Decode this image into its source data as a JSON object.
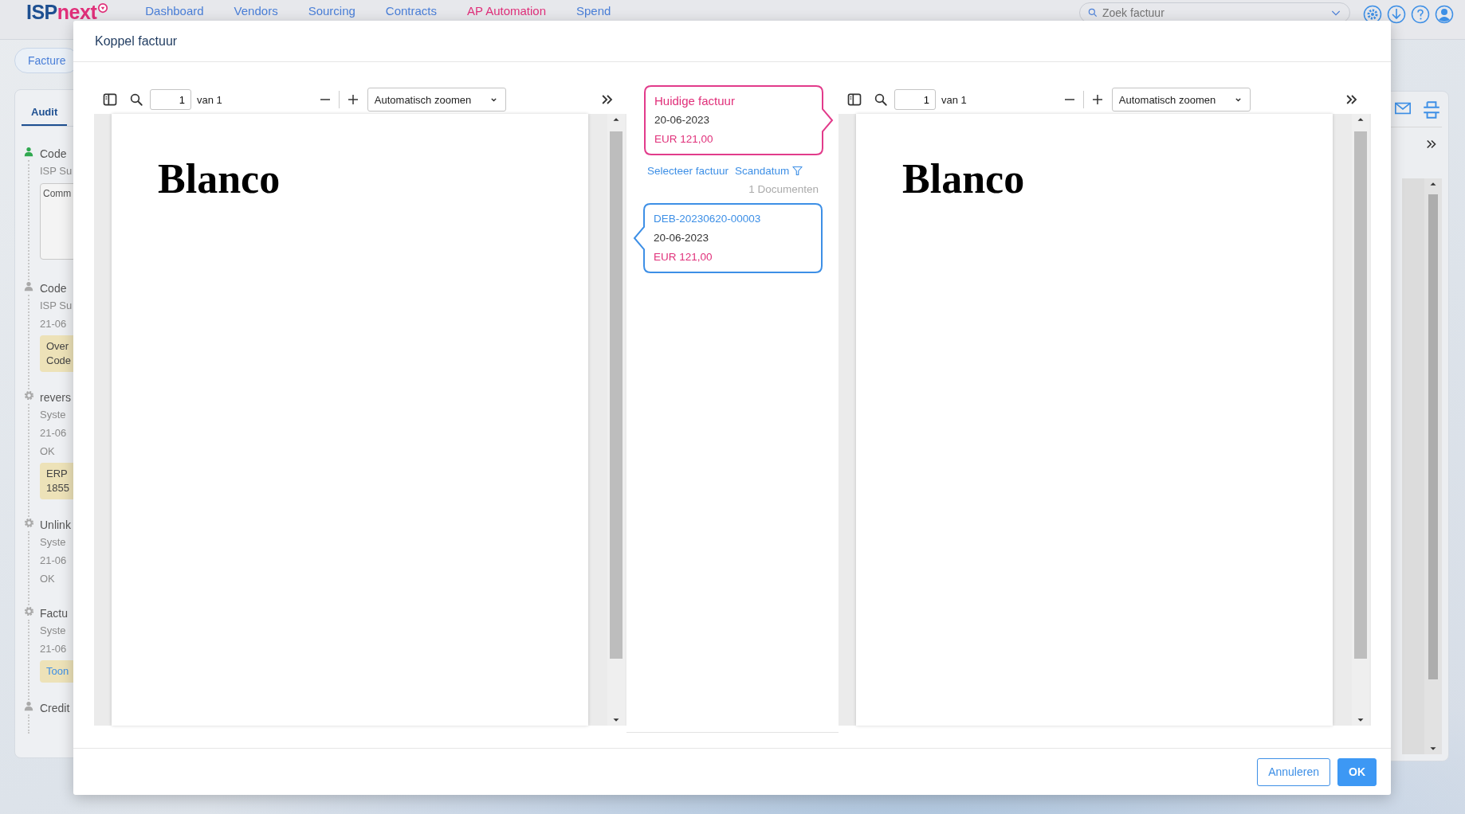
{
  "app_header": {
    "logo": {
      "prefix": "ISP",
      "suffix": "next"
    },
    "nav": [
      {
        "label": "Dashboard",
        "selected": false
      },
      {
        "label": "Vendors",
        "selected": false
      },
      {
        "label": "Sourcing",
        "selected": false
      },
      {
        "label": "Contracts",
        "selected": false
      },
      {
        "label": "AP Automation",
        "selected": true
      },
      {
        "label": "Spend",
        "selected": false
      }
    ],
    "search": {
      "placeholder": "Zoek factuur"
    }
  },
  "breadcrumb_tab": "Facture",
  "audit_panel": {
    "tabs": [
      {
        "label": "Audit",
        "selected": true
      }
    ],
    "entries": [
      {
        "kind": "user",
        "color": "#2fa84f",
        "title": "Code",
        "lines": [
          "ISP Su"
        ],
        "comment_placeholder": "Comm"
      },
      {
        "kind": "user",
        "color": "#a9a9a9",
        "title": "Code",
        "lines": [
          "ISP Su",
          "21-06"
        ],
        "note": {
          "kind": "text",
          "lines": [
            "Over",
            "Code"
          ]
        }
      },
      {
        "kind": "system",
        "color": "#a9a9a9",
        "title": "revers",
        "lines": [
          "Syste",
          "21-06",
          "OK"
        ],
        "note": {
          "kind": "text",
          "lines": [
            "ERP",
            "1855"
          ]
        }
      },
      {
        "kind": "system",
        "color": "#a9a9a9",
        "title": "Unlink",
        "lines": [
          "Syste",
          "21-06",
          "OK"
        ]
      },
      {
        "kind": "system",
        "color": "#a9a9a9",
        "title": "Factu",
        "lines": [
          "Syste",
          "21-06"
        ],
        "note": {
          "kind": "link",
          "lines": [
            "Toon"
          ]
        }
      },
      {
        "kind": "user",
        "color": "#a9a9a9",
        "title": "Credit"
      }
    ]
  },
  "dialog": {
    "title": "Koppel factuur",
    "viewers": [
      {
        "page": "1",
        "page_count": "van 1",
        "zoom": "Automatisch zoomen",
        "document_text": "Blanco"
      },
      {
        "page": "1",
        "page_count": "van 1",
        "zoom": "Automatisch zoomen",
        "document_text": "Blanco"
      }
    ],
    "current_invoice": {
      "heading": "Huidige factuur",
      "date": "20-06-2023",
      "amount": "EUR 121,00"
    },
    "select_link": "Selecteer factuur",
    "sort_link": "Scandatum",
    "document_count": "1 Documenten",
    "results": [
      {
        "number": "DEB-20230620-00003",
        "date": "20-06-2023",
        "amount": "EUR 121,00"
      }
    ],
    "buttons": [
      {
        "label": "Annuleren",
        "kind": "secondary"
      },
      {
        "label": "OK",
        "kind": "primary"
      }
    ]
  }
}
